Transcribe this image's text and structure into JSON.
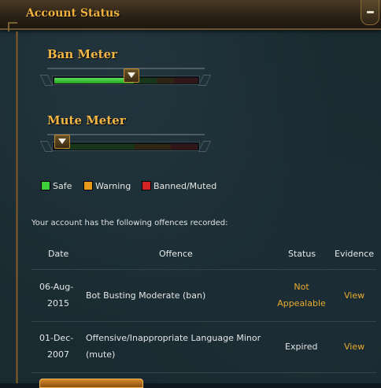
{
  "panel": {
    "title": "Account Status",
    "collapse_icon": "minus-icon"
  },
  "meters": [
    {
      "title": "Ban Meter",
      "level_fraction": 0.55
    },
    {
      "title": "Mute Meter",
      "level_fraction": 0.05
    }
  ],
  "legend": [
    {
      "label": "Safe",
      "color": "#3fcf3c"
    },
    {
      "label": "Warning",
      "color": "#e8991c"
    },
    {
      "label": "Banned/Muted",
      "color": "#d42424"
    }
  ],
  "offences": {
    "intro": "Your account has the following offences recorded:",
    "headers": {
      "date": "Date",
      "offence": "Offence",
      "status": "Status",
      "evidence": "Evidence"
    },
    "rows": [
      {
        "date_line1": "06-Aug-",
        "date_line2": "2015",
        "offence_line1": "Bot Busting Moderate (ban)",
        "offence_line2": "",
        "status_line1": "Not",
        "status_line2": "Appealable",
        "evidence": "View"
      },
      {
        "date_line1": "01-Dec-",
        "date_line2": "2007",
        "offence_line1": "Offensive/Inappropriate Language Minor",
        "offence_line2": "(mute)",
        "status_line1": "Expired",
        "status_line2": "",
        "evidence": "View"
      }
    ]
  },
  "colors": {
    "title_gold": "#f0b23c",
    "link_gold": "#e9ab2c"
  }
}
